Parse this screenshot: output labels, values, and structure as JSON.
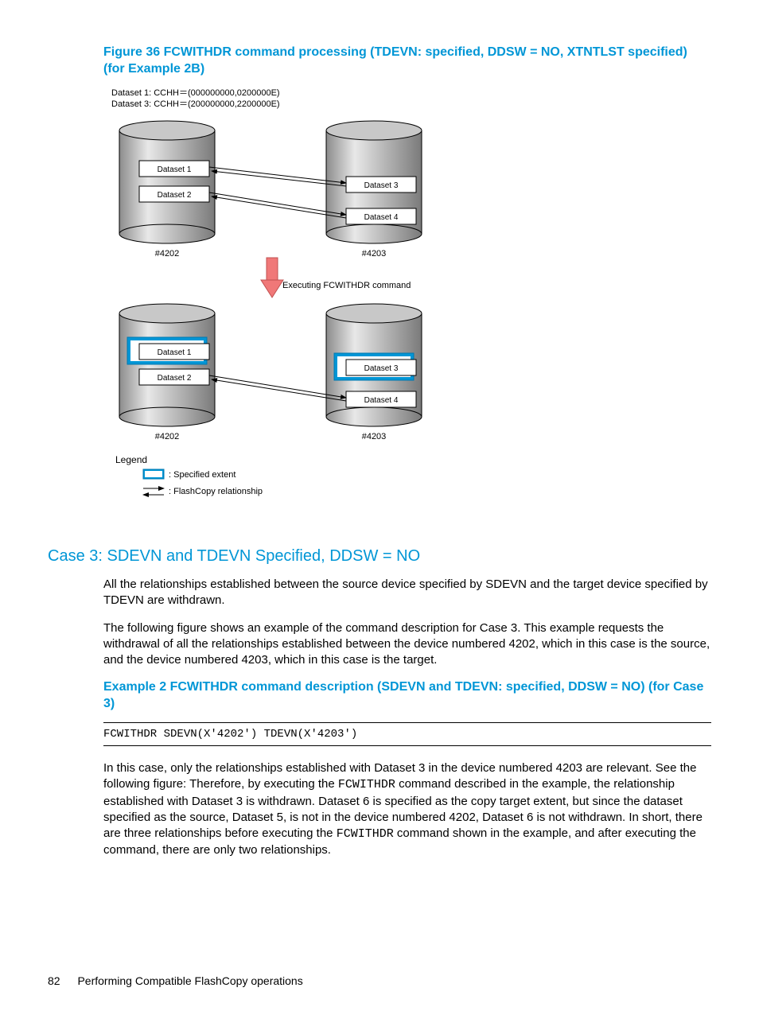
{
  "figure_caption": "Figure 36 FCWITHDR command processing (TDEVN: specified, DDSW = NO, XTNTLST specified) (for Example 2B)",
  "diagram": {
    "dataset_header1": "Dataset 1:   CCHH＝(000000000,0200000E)",
    "dataset_header3": "Dataset 3:   CCHH＝(200000000,2200000E)",
    "ds1": "Dataset 1",
    "ds2": "Dataset 2",
    "ds3": "Dataset 3",
    "ds4": "Dataset 4",
    "dev_left": "#4202",
    "dev_right": "#4203",
    "exec_label": "Executing FCWITHDR command",
    "legend_title": "Legend",
    "legend_extent": ": Specified extent",
    "legend_relation": ": FlashCopy relationship"
  },
  "h3": "Case 3: SDEVN and TDEVN Specified, DDSW = NO",
  "para1": "All the relationships established between the source device specified by SDEVN and the target device specified by TDEVN are withdrawn.",
  "para2": "The following figure shows an example of the command description for Case 3. This example requests the withdrawal of all the relationships established between the device numbered 4202, which in this case is the source, and the device numbered 4203, which in this case is the target.",
  "example_caption": "Example 2 FCWITHDR command description (SDEVN and TDEVN: specified, DDSW = NO) (for Case 3)",
  "code_line": "FCWITHDR SDEVN(X'4202') TDEVN(X'4203')",
  "para3_a": "In this case, only the relationships established with Dataset 3 in the device numbered 4203 are relevant. See the following figure: Therefore, by executing the ",
  "para3_b": "FCWITHDR",
  "para3_c": " command described in the example, the relationship established with Dataset 3 is withdrawn. Dataset 6 is specified as the copy target extent, but since the dataset specified as the source, Dataset 5, is not in the device numbered 4202, Dataset 6 is not withdrawn. In short, there are three relationships before executing the ",
  "para3_d": "FCWITHDR",
  "para3_e": " command shown in the example, and after executing the command, there are only two relationships.",
  "footer_page": "82",
  "footer_title": "Performing Compatible FlashCopy operations"
}
